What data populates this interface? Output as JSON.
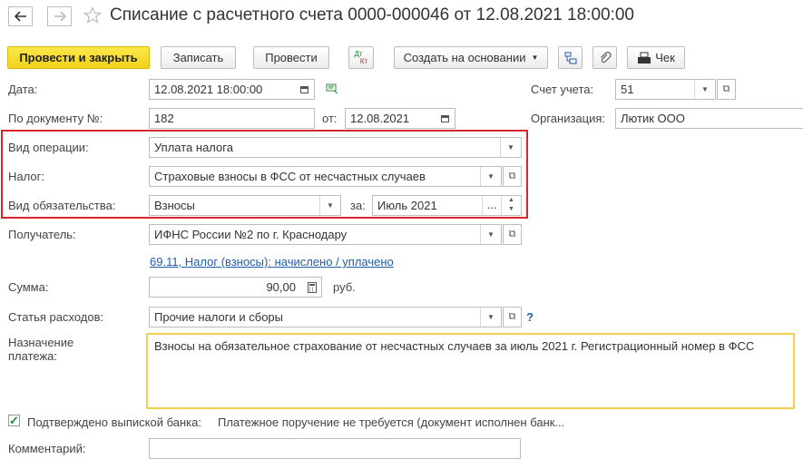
{
  "header": {
    "title": "Списание с расчетного счета 0000-000046 от 12.08.2021 18:00:00",
    "back_icon": "arrow-left-icon",
    "forward_icon": "arrow-right-icon",
    "favorite_icon": "star-icon"
  },
  "toolbar": {
    "post_close": "Провести и закрыть",
    "save": "Записать",
    "post": "Провести",
    "dt_kt_top": "Дт",
    "dt_kt_bottom": "Кт",
    "create_based": "Создать на основании",
    "cheque": "Чек"
  },
  "form": {
    "date_label": "Дата:",
    "date_value": "12.08.2021 18:00:00",
    "account_label": "Счет учета:",
    "account_value": "51",
    "doc_num_label": "По документу №:",
    "doc_num_value": "182",
    "from_label": "от:",
    "from_value": "12.08.2021",
    "org_label": "Организация:",
    "org_value": "Лютик ООО",
    "op_type_label": "Вид операции:",
    "op_type_value": "Уплата налога",
    "tax_label": "Налог:",
    "tax_value": "Страховые взносы в ФСС от несчастных случаев",
    "obligation_label": "Вид обязательства:",
    "obligation_value": "Взносы",
    "for_label": "за:",
    "period_value": "Июль 2021",
    "recipient_label": "Получатель:",
    "recipient_value": "ИФНС России №2 по г. Краснодару",
    "account_link": "69.11, Налог (взносы): начислено / уплачено",
    "sum_label": "Сумма:",
    "sum_value": "90,00",
    "currency": "руб.",
    "expense_label": "Статья расходов:",
    "expense_value": "Прочие налоги и сборы",
    "help": "?",
    "purpose_label_1": "Назначение",
    "purpose_label_2": "платежа:",
    "purpose_value": "Взносы на обязательное страхование от несчастных случаев за июль 2021 г. Регистрационный номер в ФСС",
    "confirmed_label": "Подтверждено выпиской банка:",
    "confirmed_checked": true,
    "payment_order_text": "Платежное поручение не требуется (документ исполнен банк...",
    "comment_label": "Комментарий:",
    "comment_value": ""
  },
  "colors": {
    "accent_yellow": "#f2d21b",
    "highlight_red": "#d6262b",
    "link_blue": "#1f5fa7",
    "focus_yellow": "#f3cf4e"
  }
}
